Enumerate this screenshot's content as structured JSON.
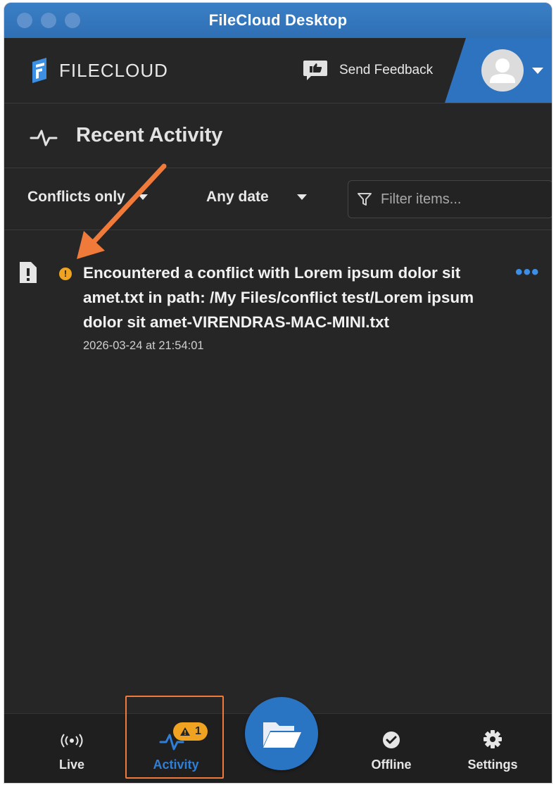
{
  "window": {
    "title": "FileCloud Desktop"
  },
  "header": {
    "logo_text": "FILECLOUD",
    "feedback_label": "Send Feedback"
  },
  "section": {
    "title": "Recent Activity"
  },
  "filters": {
    "type_value": "Conflicts only",
    "date_value": "Any date",
    "search_placeholder": "Filter items..."
  },
  "activity": {
    "items": [
      {
        "status_icon": "!",
        "message": "Encountered a conflict with Lorem ipsum dolor sit amet.txt in path: /My Files/conflict test/Lorem ipsum dolor sit amet-VIRENDRAS-MAC-MINI.txt",
        "timestamp": "2026-03-24 at 21:54:01",
        "more_label": "•••"
      }
    ]
  },
  "nav": {
    "live_label": "Live",
    "activity_label": "Activity",
    "activity_badge": "1",
    "offline_label": "Offline",
    "settings_label": "Settings"
  },
  "colors": {
    "accent": "#2e73c0",
    "warning": "#f0a321",
    "annotation": "#f07a3a",
    "background": "#262626"
  }
}
